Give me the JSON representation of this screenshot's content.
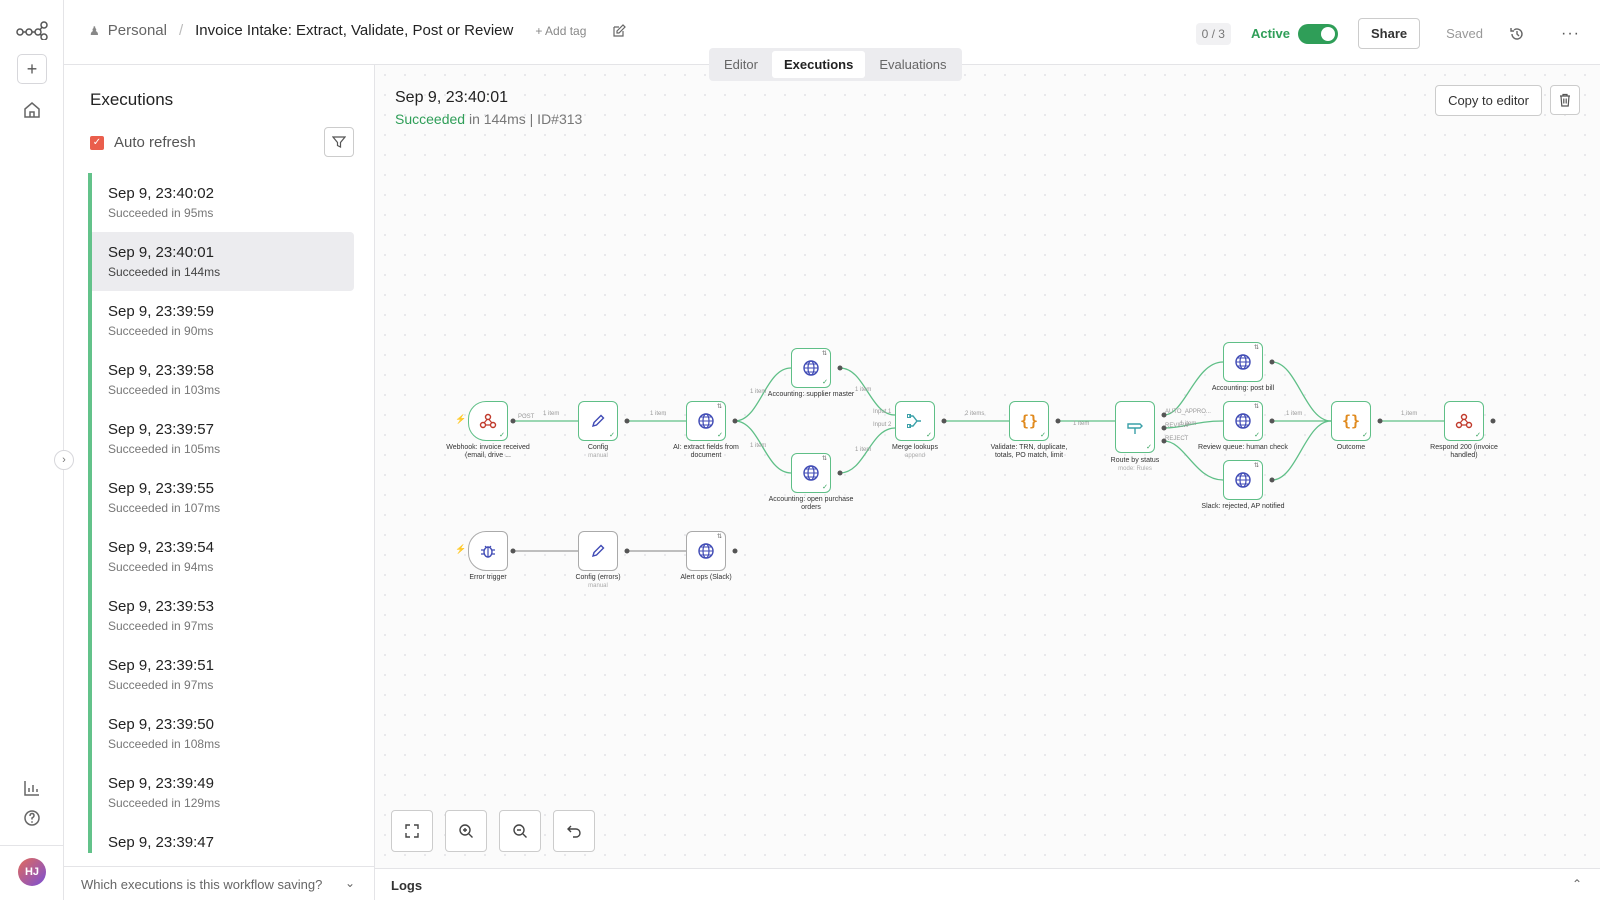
{
  "header": {
    "project": "Personal",
    "workflow_name": "Invoice Intake: Extract, Validate, Post or Review",
    "add_tag": "+ Add tag",
    "counter": "0 / 3",
    "active_label": "Active",
    "share": "Share",
    "saved": "Saved"
  },
  "tabs": [
    "Editor",
    "Executions",
    "Evaluations"
  ],
  "executions": {
    "title": "Executions",
    "auto_refresh": "Auto refresh",
    "items": [
      {
        "time": "Sep 9, 23:40:02",
        "status": "Succeeded in 95ms"
      },
      {
        "time": "Sep 9, 23:40:01",
        "status": "Succeeded in 144ms"
      },
      {
        "time": "Sep 9, 23:39:59",
        "status": "Succeeded in 90ms"
      },
      {
        "time": "Sep 9, 23:39:58",
        "status": "Succeeded in 103ms"
      },
      {
        "time": "Sep 9, 23:39:57",
        "status": "Succeeded in 105ms"
      },
      {
        "time": "Sep 9, 23:39:55",
        "status": "Succeeded in 107ms"
      },
      {
        "time": "Sep 9, 23:39:54",
        "status": "Succeeded in 94ms"
      },
      {
        "time": "Sep 9, 23:39:53",
        "status": "Succeeded in 97ms"
      },
      {
        "time": "Sep 9, 23:39:51",
        "status": "Succeeded in 97ms"
      },
      {
        "time": "Sep 9, 23:39:50",
        "status": "Succeeded in 108ms"
      },
      {
        "time": "Sep 9, 23:39:49",
        "status": "Succeeded in 129ms"
      },
      {
        "time": "Sep 9, 23:39:47",
        "status": ""
      }
    ],
    "footer_question": "Which executions is this workflow saving?"
  },
  "run": {
    "title": "Sep 9, 23:40:01",
    "status_word": "Succeeded",
    "status_rest": " in 144ms | ID#313",
    "copy_to_editor": "Copy to editor"
  },
  "nodes": {
    "webhook": "Webhook: invoice received (email, drive ...",
    "config": "Config",
    "config_sub": "manual",
    "ai_extract": "AI: extract fields from document",
    "supplier_master": "Accounting: supplier master",
    "open_pos": "Accounting: open purchase orders",
    "merge": "Merge lookups",
    "merge_sub": "append",
    "validate": "Validate: TRN, duplicate, totals, PO match, limit",
    "route": "Route by status",
    "route_sub": "mode: Rules",
    "post_bill": "Accounting: post bill",
    "review_queue": "Review queue: human check",
    "slack_rejected": "Slack: rejected, AP notified",
    "outcome": "Outcome",
    "respond": "Respond 200 (invoice handled)",
    "error_trigger": "Error trigger",
    "config_errors": "Config (errors)",
    "alert_ops": "Alert ops (Slack)"
  },
  "edges": {
    "post": "POST",
    "one_item": "1 item",
    "two_items": "2 items",
    "input1": "Input 1",
    "input2": "Input 2",
    "auto_approve": "AUTO_APPRO...",
    "review": "REVIEW",
    "reject": "REJECT"
  },
  "logs": {
    "label": "Logs"
  },
  "user": {
    "initials": "HJ"
  }
}
